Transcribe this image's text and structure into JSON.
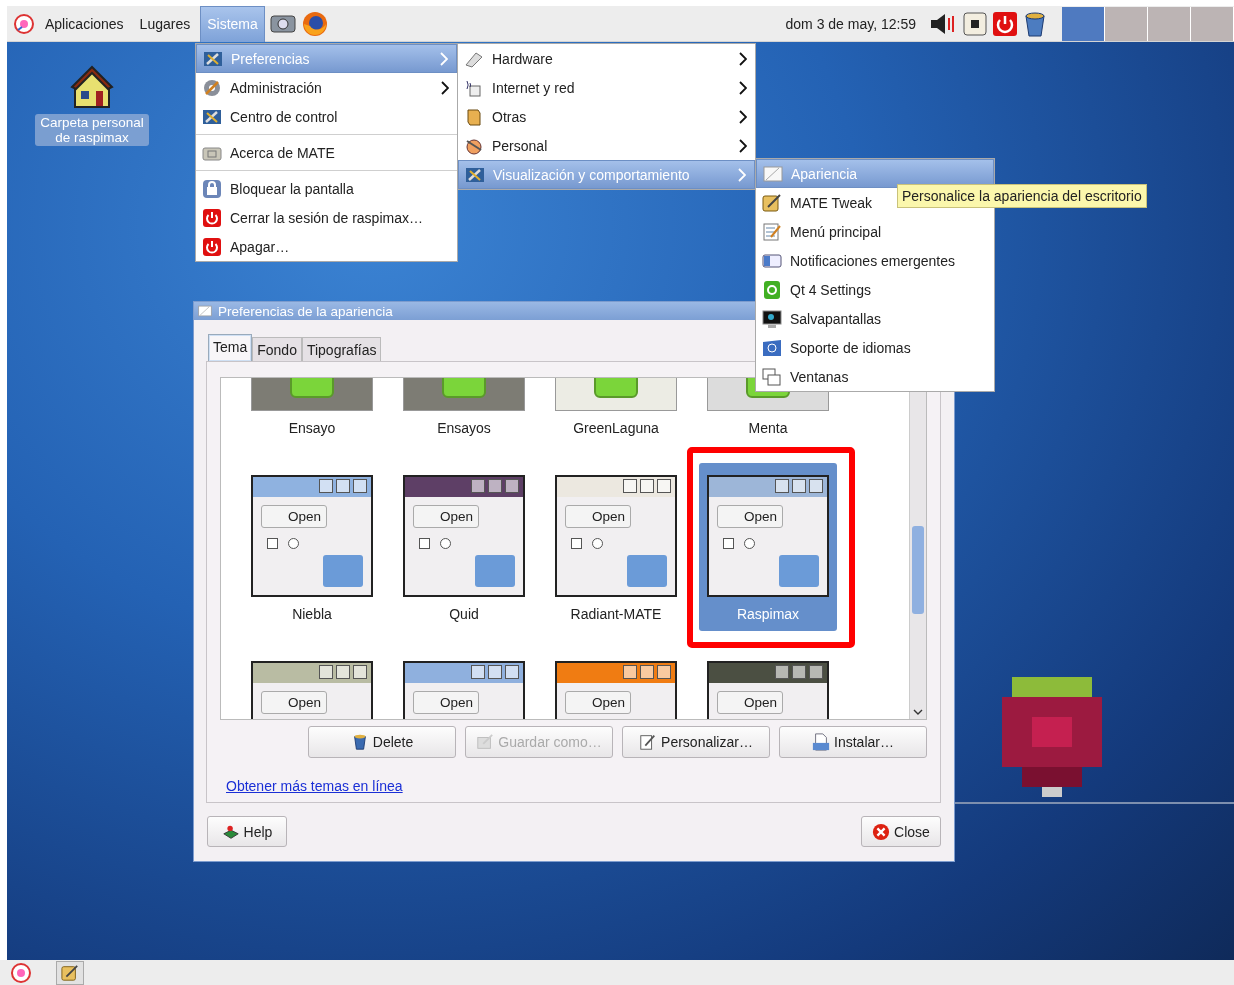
{
  "top_panel": {
    "menus": [
      {
        "label": "Aplicaciones",
        "selected": false
      },
      {
        "label": "Lugares",
        "selected": false
      },
      {
        "label": "Sistema",
        "selected": true
      }
    ],
    "clock": "dom  3 de may, 12:59",
    "workspaces": [
      {
        "selected": true
      },
      {
        "selected": false
      },
      {
        "selected": false
      },
      {
        "selected": false
      }
    ]
  },
  "desktop_icons": [
    {
      "label": "Carpeta personal de raspimax"
    }
  ],
  "system_menu": {
    "sections": [
      [
        {
          "label": "Preferencias",
          "has_submenu": true,
          "selected": true
        },
        {
          "label": "Administración",
          "has_submenu": true,
          "selected": false
        },
        {
          "label": "Centro de control",
          "has_submenu": false,
          "selected": false
        }
      ],
      [
        {
          "label": "Acerca de MATE",
          "has_submenu": false,
          "selected": false
        }
      ],
      [
        {
          "label": "Bloquear la pantalla",
          "has_submenu": false,
          "selected": false
        },
        {
          "label": "Cerrar la sesión de raspimax…",
          "has_submenu": false,
          "selected": false
        },
        {
          "label": "Apagar…",
          "has_submenu": false,
          "selected": false
        }
      ]
    ]
  },
  "preferences_menu": {
    "items": [
      {
        "label": "Hardware",
        "has_submenu": true,
        "selected": false
      },
      {
        "label": "Internet y red",
        "has_submenu": true,
        "selected": false
      },
      {
        "label": "Otras",
        "has_submenu": true,
        "selected": false
      },
      {
        "label": "Personal",
        "has_submenu": true,
        "selected": false
      },
      {
        "label": "Visualización y comportamiento",
        "has_submenu": true,
        "selected": true
      }
    ]
  },
  "appearance_menu": {
    "items": [
      {
        "label": "Apariencia",
        "selected": true
      },
      {
        "label": "MATE Tweak",
        "selected": false
      },
      {
        "label": "Menú principal",
        "selected": false
      },
      {
        "label": "Notificaciones emergentes",
        "selected": false
      },
      {
        "label": "Qt 4 Settings",
        "selected": false
      },
      {
        "label": "Salvapantallas",
        "selected": false
      },
      {
        "label": "Soporte de idiomas",
        "selected": false
      },
      {
        "label": "Ventanas",
        "selected": false
      }
    ]
  },
  "tooltip": "Personalice la apariencia del escritorio",
  "dialog": {
    "title": "Preferencias de la apariencia",
    "tabs": [
      {
        "label": "Tema",
        "selected": true
      },
      {
        "label": "Fondo",
        "selected": false
      },
      {
        "label": "Tipografías",
        "selected": false
      }
    ],
    "theme_rows": [
      [
        {
          "name": "Ensayo",
          "kind": "logo",
          "color": "#7d7c74",
          "selected": false
        },
        {
          "name": "Ensayos",
          "kind": "logo",
          "color": "#7d7c74",
          "selected": false
        },
        {
          "name": "GreenLaguna",
          "kind": "logo",
          "color": "#ecece4",
          "selected": false
        },
        {
          "name": "Menta",
          "kind": "logo",
          "color": "#dcdcdc",
          "selected": false
        }
      ],
      [
        {
          "name": "Niebla",
          "kind": "window",
          "color": "#8fb2e0",
          "button": "Open",
          "selected": false
        },
        {
          "name": "Quid",
          "kind": "window",
          "color": "#5e3f66",
          "button": "Open",
          "selected": false
        },
        {
          "name": "Radiant-MATE",
          "kind": "window",
          "color": "#ece8e0",
          "button": "Open",
          "selected": false
        },
        {
          "name": "Raspimax",
          "kind": "window",
          "color": "#9db6d8",
          "button": "Open",
          "selected": true
        }
      ],
      [
        {
          "kind": "window",
          "color": "#b9bca3",
          "button": "Open",
          "selected": false
        },
        {
          "kind": "window",
          "color": "#8fb0de",
          "button": "Open",
          "selected": false
        },
        {
          "kind": "window",
          "color": "#f07c12",
          "button": "Open",
          "selected": false
        },
        {
          "kind": "window",
          "color": "#4b4f42",
          "button": "Open",
          "selected": false
        }
      ]
    ],
    "buttons": [
      {
        "label": "Delete",
        "disabled": false
      },
      {
        "label": "Guardar como…",
        "disabled": true
      },
      {
        "label": "Personalizar…",
        "disabled": false
      },
      {
        "label": "Instalar…",
        "disabled": false
      }
    ],
    "link": "Obtener más temas en línea",
    "help_button": "Help",
    "close_button": "Close"
  }
}
